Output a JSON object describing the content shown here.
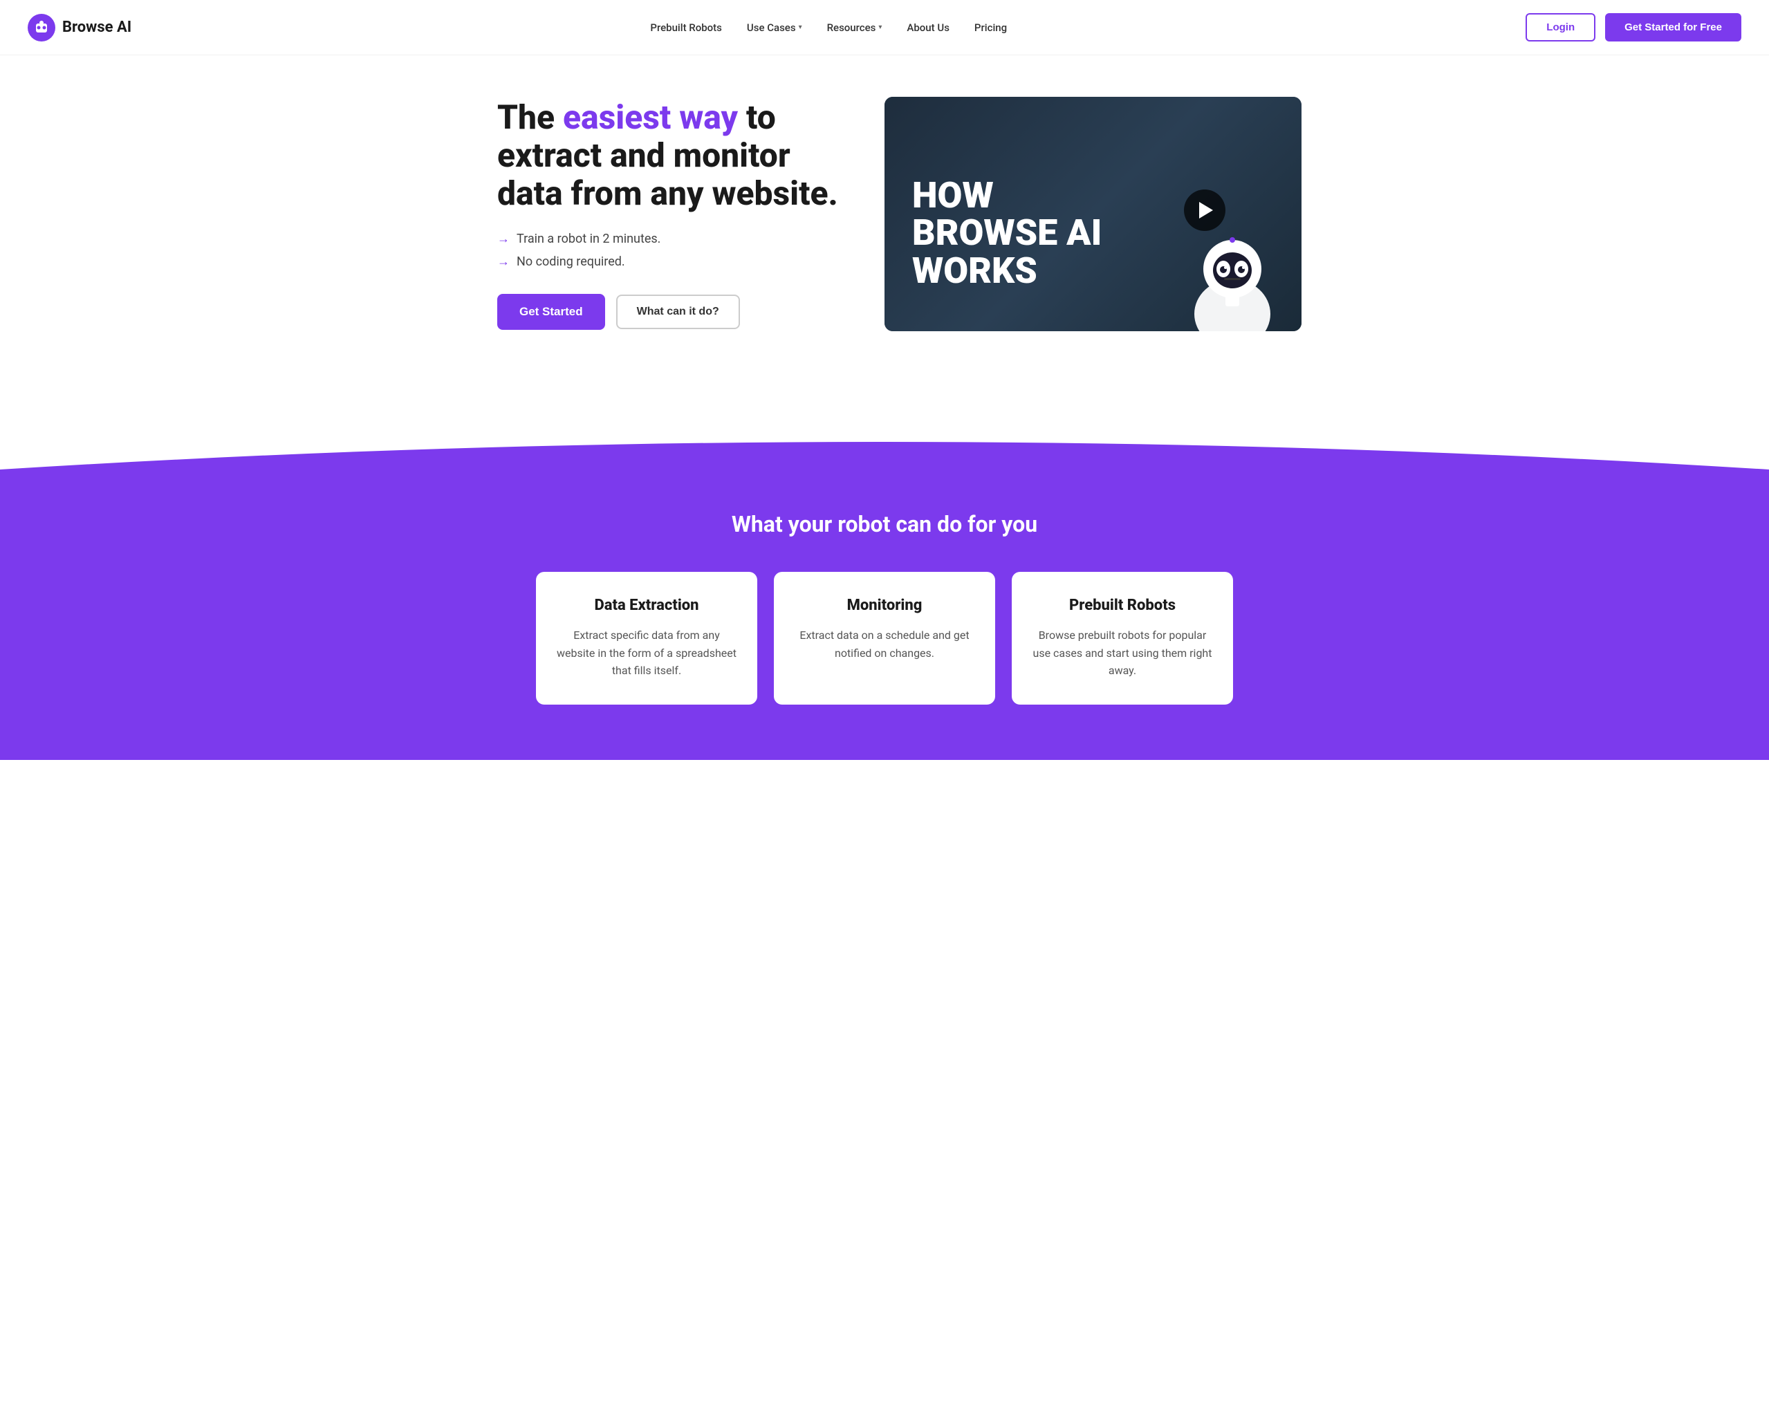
{
  "brand": {
    "name": "Browse AI",
    "logo_alt": "Browse AI Logo"
  },
  "navbar": {
    "links": [
      {
        "label": "Prebuilt Robots",
        "has_dropdown": false
      },
      {
        "label": "Use Cases",
        "has_dropdown": true
      },
      {
        "label": "Resources",
        "has_dropdown": true
      },
      {
        "label": "About Us",
        "has_dropdown": false
      },
      {
        "label": "Pricing",
        "has_dropdown": false
      }
    ],
    "login_label": "Login",
    "cta_label": "Get Started for Free"
  },
  "hero": {
    "title_part1": "The ",
    "title_highlight": "easiest way",
    "title_part2": " to extract and monitor data from any website.",
    "features": [
      "Train a robot in 2 minutes.",
      "No coding required."
    ],
    "btn_get_started": "Get Started",
    "btn_what_can": "What can it do?",
    "video": {
      "title_line1": "HOW",
      "title_line2": "BROWSE AI",
      "title_line3": "WORKS"
    }
  },
  "purple_section": {
    "title": "What your robot can do for you",
    "cards": [
      {
        "title": "Data Extraction",
        "description": "Extract specific data from any website in the form of a spreadsheet that fills itself."
      },
      {
        "title": "Monitoring",
        "description": "Extract data on a schedule and get notified on changes."
      },
      {
        "title": "Prebuilt Robots",
        "description": "Browse prebuilt robots for popular use cases and start using them right away."
      }
    ]
  }
}
